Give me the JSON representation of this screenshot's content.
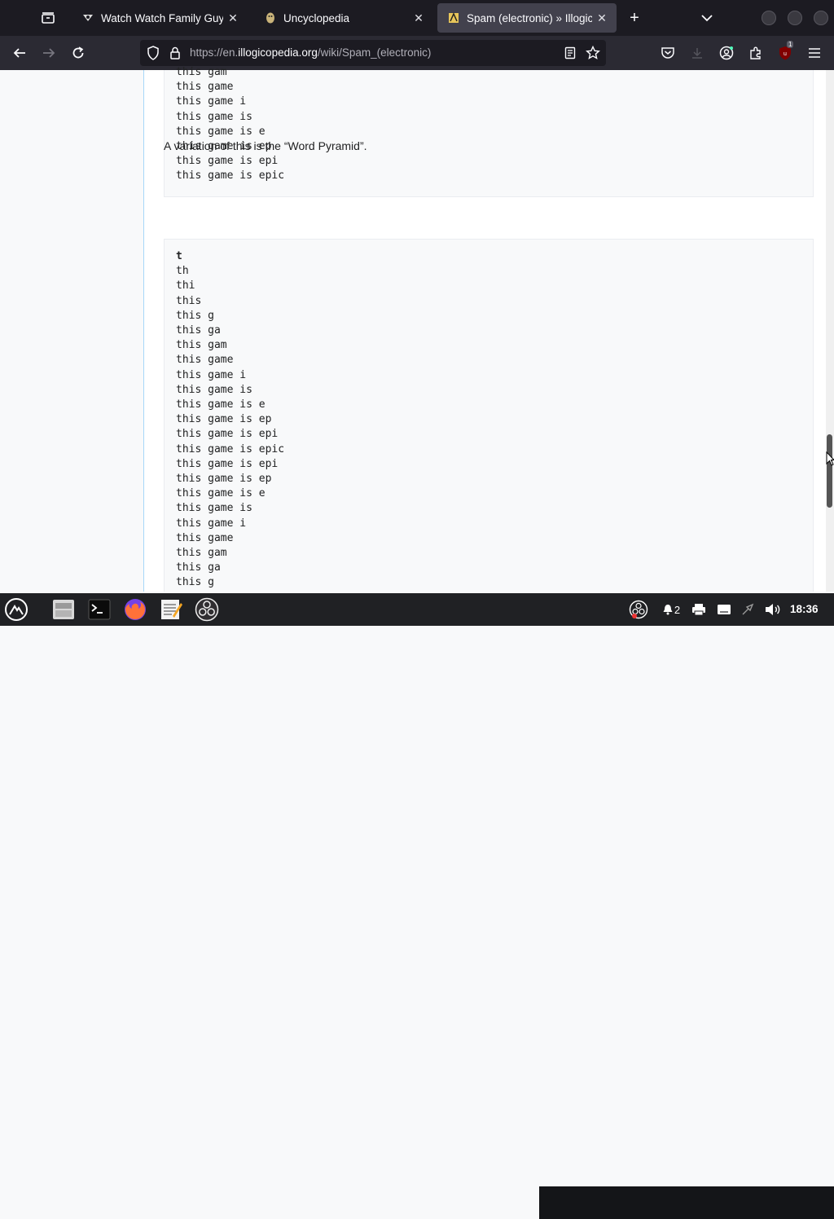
{
  "browser": {
    "tabs": [
      {
        "title": "Watch Watch Family Guy Onli",
        "active": false,
        "favicon": "family-guy-favicon"
      },
      {
        "title": "Uncyclopedia",
        "active": false,
        "favicon": "uncyclopedia-potato-favicon"
      },
      {
        "title": "Spam (electronic) » Illogicope",
        "active": true,
        "favicon": "illogicopedia-favicon"
      }
    ],
    "close_glyph": "✕",
    "new_tab_glyph": "+",
    "url": {
      "prefix": "https://en.",
      "host": "illogicopedia.org",
      "path": "/wiki/Spam_(electronic)"
    }
  },
  "page": {
    "code_block_1": [
      "this gam",
      "this game",
      "this game i",
      "this game is",
      "this game is e",
      "this game is ep",
      "this game is epi",
      "this game is epic"
    ],
    "variation_text": "A variation of this is the “Word Pyramid”.",
    "code_block_2": [
      "t",
      "th",
      "thi",
      "this",
      "this g",
      "this ga",
      "this gam",
      "this game",
      "this game i",
      "this game is",
      "this game is e",
      "this game is ep",
      "this game is epi",
      "this game is epic",
      "this game is epi",
      "this game is ep",
      "this game is e",
      "this game is",
      "this game i",
      "this game",
      "this gam",
      "this ga",
      "this g"
    ]
  },
  "taskbar": {
    "notification_count": "2",
    "clock": "18:36",
    "extension_badge": "1"
  }
}
